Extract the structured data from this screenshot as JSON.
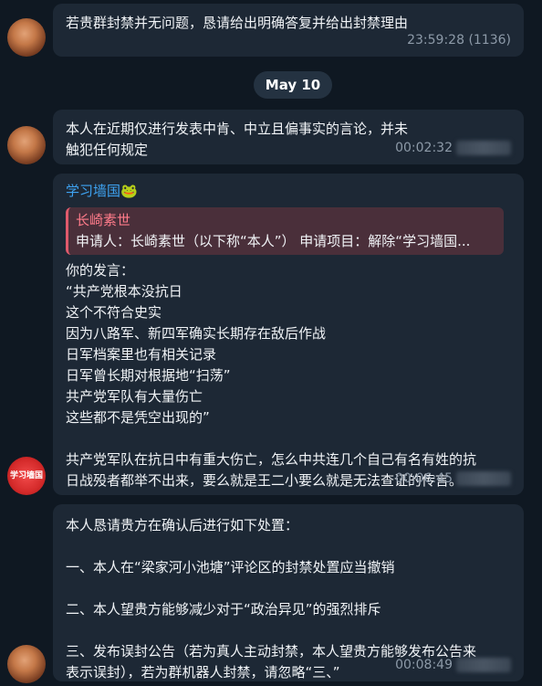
{
  "messages": [
    {
      "text": "若贵群封禁并无问题，恳请给出明确答复并给出封禁理由",
      "time": "23:59:28",
      "views": "(1136)"
    }
  ],
  "date_separator": "May 10",
  "msg2": {
    "text": "本人在近期仅进行发表中肯、中立且偏事实的言论，并未触犯任何规定",
    "time": "00:02:32"
  },
  "msg3": {
    "sender": "学习墙国",
    "sender_emoji": "🐸",
    "quote_name": "长崎素世",
    "quote_text": "申请人：长崎素世（以下称“本人”） 申请项目：解除“学习墙国...",
    "lines": [
      "你的发言：",
      "“共产党根本没抗日",
      "这个不符合史实",
      "因为八路军、新四军确实长期存在敌后作战",
      "日军档案里也有相关记录",
      "日军曾长期对根据地“扫荡”",
      "共产党军队有大量伤亡",
      "这些都不是凭空出现的”",
      "",
      "共产党军队在抗日中有重大伤亡，怎么中共连几个自己有名有姓的抗",
      "日战殁者都举不出来，要么就是王二小要么就是无法查证的传言。"
    ],
    "time": "00:06:45",
    "avatar_text": "学习墙国"
  },
  "msg4": {
    "lines": [
      "本人恳请贵方在确认后进行如下处置：",
      "",
      "一、本人在“梁家河小池塘”评论区的封禁处置应当撤销",
      "",
      "二、本人望贵方能够减少对于“政治异见”的强烈排斥",
      "",
      "三、发布误封公告（若为真人主动封禁，本人望贵方能够发布公告来",
      "表示误封），若为群机器人封禁，请忽略“三、”"
    ],
    "time": "00:08:49"
  }
}
